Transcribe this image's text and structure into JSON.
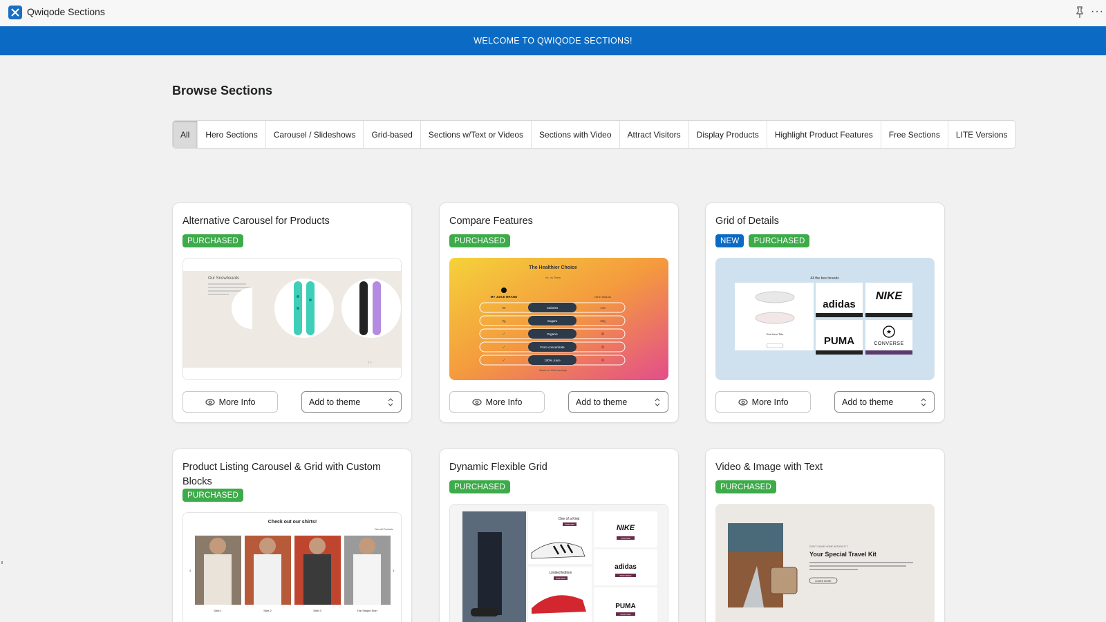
{
  "app": {
    "title": "Qwiqode Sections"
  },
  "banner": {
    "text": "WELCOME TO QWIQODE SECTIONS!"
  },
  "page": {
    "title": "Browse Sections"
  },
  "tabs": [
    {
      "label": "All",
      "active": true
    },
    {
      "label": "Hero Sections"
    },
    {
      "label": "Carousel / Slideshows"
    },
    {
      "label": "Grid-based"
    },
    {
      "label": "Sections w/Text or Videos"
    },
    {
      "label": "Sections with Video"
    },
    {
      "label": "Attract Visitors"
    },
    {
      "label": "Display Products"
    },
    {
      "label": "Highlight Product Features"
    },
    {
      "label": "Free Sections"
    },
    {
      "label": "LITE Versions"
    }
  ],
  "common": {
    "more_info": "More Info",
    "add_to_theme": "Add to theme"
  },
  "cards": [
    {
      "title": "Alternative Carousel for Products",
      "badges": [
        "PURCHASED"
      ],
      "preview": {
        "heading": "Our Snowboards",
        "dots": "‹ ›"
      }
    },
    {
      "title": "Compare Features",
      "badges": [
        "PURCHASED"
      ],
      "preview": {
        "heading": "The Healthier Choice",
        "sub": "Vs. vs Them",
        "brand_mine": "MY JUICE BRAND",
        "brand_other": "Other Brands",
        "rows": [
          {
            "left": "90",
            "mid": "Calories",
            "right": "140"
          },
          {
            "left": "0g",
            "mid": "Sugars",
            "right": "20g"
          },
          {
            "left": "✓",
            "mid": "Organic",
            "right": "⊗"
          },
          {
            "left": "✓",
            "mid": "From concentrate",
            "right": "⊗"
          },
          {
            "left": "✓",
            "mid": "100% Juice",
            "right": "⊗"
          }
        ],
        "footnote": "Based on 100ml servings"
      }
    },
    {
      "title": "Grid of Details",
      "badges": [
        "NEW",
        "PURCHASED"
      ],
      "preview": {
        "heading": "All the best brands",
        "item_title": "Grid Item Title",
        "brands": [
          "adidas",
          "NIKE",
          "PUMA",
          "CONVERSE"
        ]
      }
    },
    {
      "title": "Product Listing Carousel & Grid with Custom Blocks",
      "badges": [
        "PURCHASED"
      ],
      "preview": {
        "heading": "Check out our shirts!",
        "link": "View all Products",
        "items": [
          "Shirt 1",
          "Shirt 2",
          "Shirt 3",
          "The Simple Shirt"
        ]
      }
    },
    {
      "title": "Dynamic Flexible Grid",
      "badges": [
        "PURCHASED"
      ],
      "preview": {
        "label1": "One of a Kind",
        "label2": "Limited Edition",
        "shop": "SHOP NOW",
        "shop_nike": "SHOP NIKE",
        "shop_adidas": "SHOP ADIDAS",
        "shop_puma": "SHOP PUMA",
        "brands": [
          "NIKE",
          "adidas",
          "PUMA"
        ]
      }
    },
    {
      "title": "Video & Image with Text",
      "badges": [
        "PURCHASED"
      ],
      "preview": {
        "eyebrow": "DON'T LEAVE HOME WITHOUT IT",
        "heading": "Your Special Travel Kit",
        "cta": "LEARN MORE"
      }
    }
  ],
  "colors": {
    "banner": "#0b6bc4",
    "purchased": "#3dab4a",
    "new": "#0b6bc4"
  }
}
